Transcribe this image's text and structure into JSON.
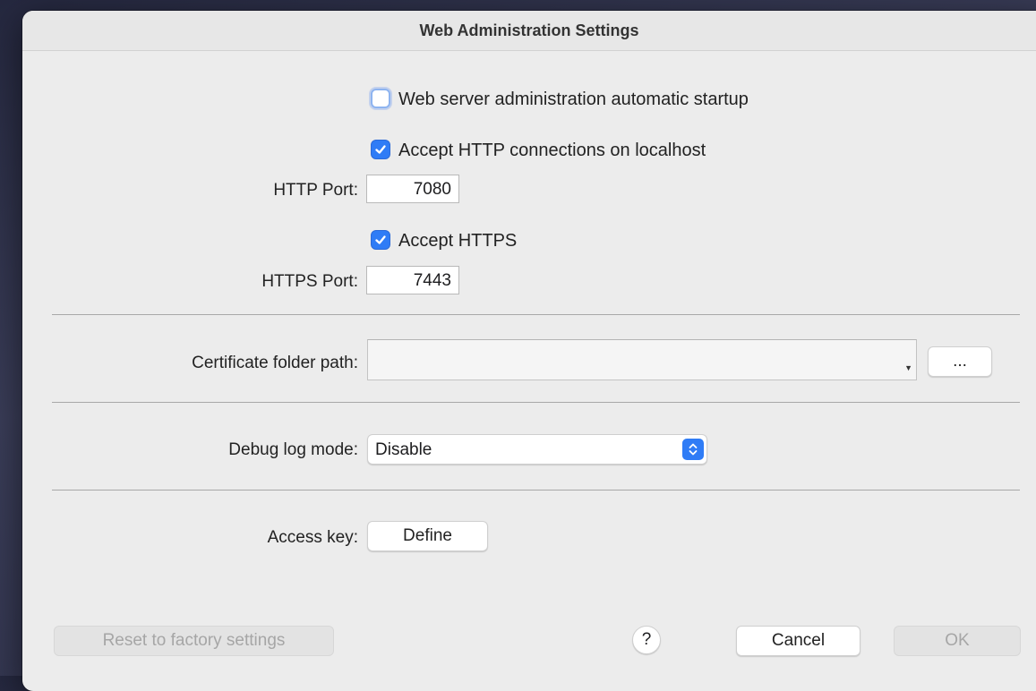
{
  "window": {
    "title": "Web Administration Settings"
  },
  "options": {
    "auto_startup": {
      "label": "Web server administration automatic startup",
      "checked": false
    },
    "accept_http": {
      "label": "Accept HTTP connections on localhost",
      "checked": true
    },
    "http_port": {
      "label": "HTTP Port:",
      "value": "7080"
    },
    "accept_https": {
      "label": "Accept HTTPS",
      "checked": true
    },
    "https_port": {
      "label": "HTTPS Port:",
      "value": "7443"
    }
  },
  "certificate": {
    "label": "Certificate folder path:",
    "value": "",
    "browse_label": "..."
  },
  "debug": {
    "label": "Debug log mode:",
    "selected": "Disable"
  },
  "access_key": {
    "label": "Access key:",
    "button_label": "Define"
  },
  "footer": {
    "reset_label": "Reset to factory settings",
    "help_label": "?",
    "cancel_label": "Cancel",
    "ok_label": "OK"
  },
  "colors": {
    "accent": "#2f7cf6",
    "window_bg": "#ececec"
  }
}
